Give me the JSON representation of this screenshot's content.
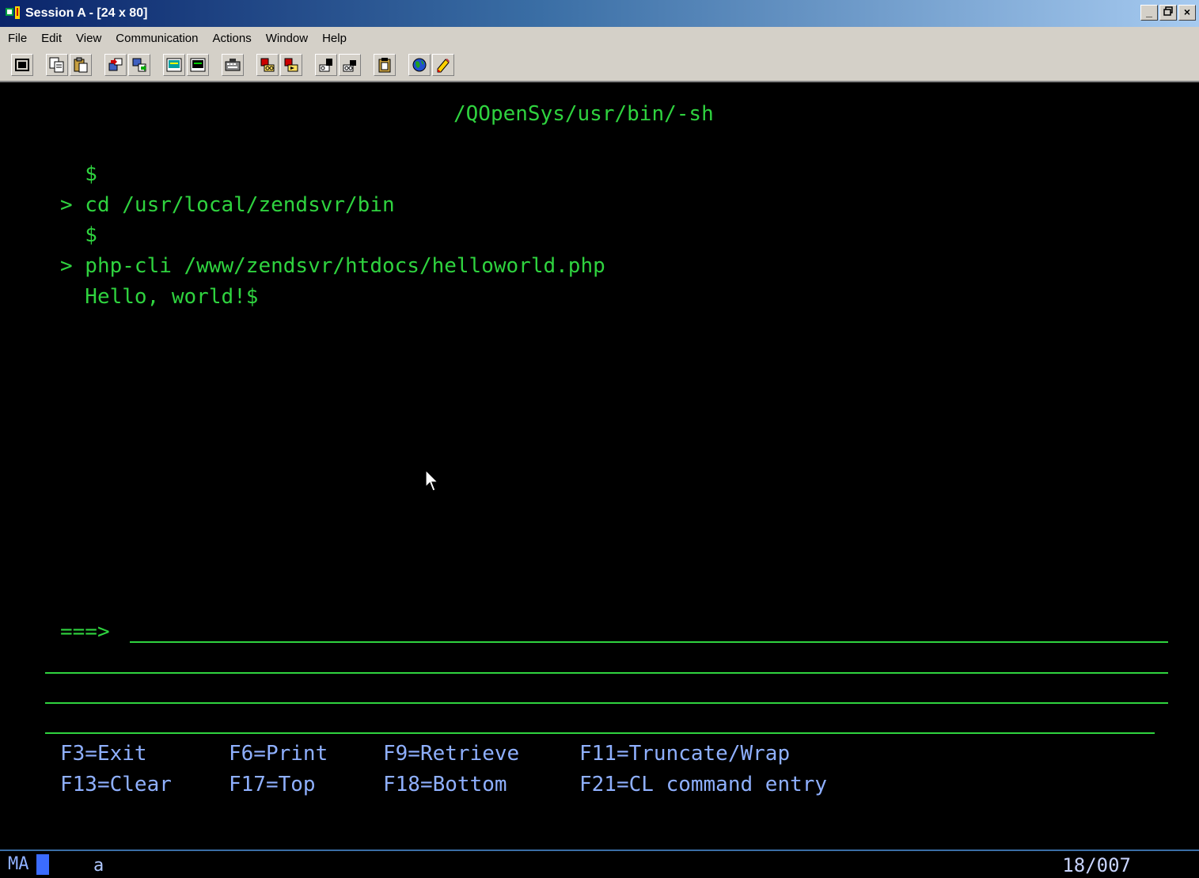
{
  "window": {
    "title": "Session A - [24 x 80]",
    "controls": [
      "_",
      " ",
      "×"
    ]
  },
  "menu": {
    "items": [
      "File",
      "Edit",
      "View",
      "Communication",
      "Actions",
      "Window",
      "Help"
    ]
  },
  "toolbar": {
    "icons": [
      "display-icon",
      "copy-icon",
      "paste-icon",
      "send-file-icon",
      "receive-file-icon",
      "screen-icon",
      "screen-alt-icon",
      "keyboard-icon",
      "macro-record-icon",
      "macro-play-icon",
      "macro-stop-icon",
      "macro-edit-icon",
      "clipboard-icon",
      "globe-icon",
      "help-pencil-icon"
    ]
  },
  "terminal": {
    "header": "/QOpenSys/usr/bin/-sh",
    "lines": [
      "  $",
      "> cd /usr/local/zendsvr/bin",
      "  $",
      "> php-cli /www/zendsvr/htdocs/helloworld.php",
      "  Hello, world!$"
    ],
    "prompt": "===>",
    "function_keys": {
      "row1": [
        "F3=Exit",
        "F6=Print",
        "F9=Retrieve",
        "F11=Truncate/Wrap"
      ],
      "row2": [
        "F13=Clear",
        "F17=Top",
        "F18=Bottom",
        "F21=CL command entry"
      ]
    },
    "colors": {
      "text": "#2fd33f",
      "fkeys": "#8fb0ff",
      "background": "#000000"
    }
  },
  "status": {
    "mode": "MA",
    "indicator": "a",
    "cursor_position": "18/007"
  }
}
